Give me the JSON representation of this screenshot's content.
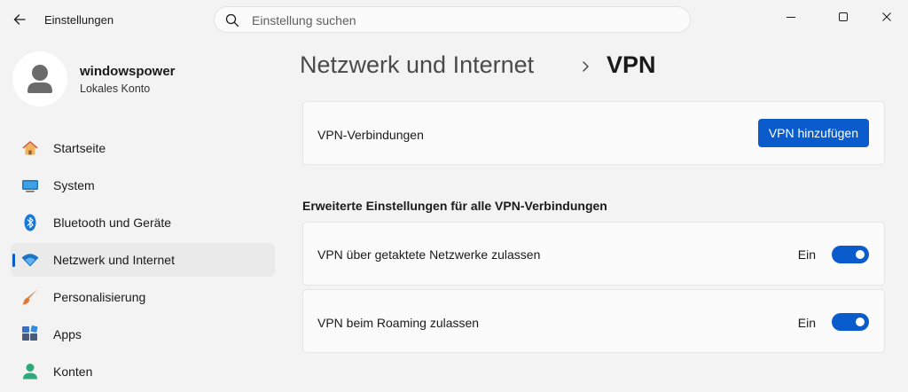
{
  "window": {
    "title": "Einstellungen"
  },
  "search": {
    "placeholder": "Einstellung suchen"
  },
  "profile": {
    "name": "windowspower",
    "account_type": "Lokales Konto"
  },
  "sidebar": {
    "items": [
      {
        "label": "Startseite",
        "icon": "home-icon"
      },
      {
        "label": "System",
        "icon": "monitor-icon"
      },
      {
        "label": "Bluetooth und Geräte",
        "icon": "bluetooth-icon"
      },
      {
        "label": "Netzwerk und Internet",
        "icon": "wifi-icon",
        "active": true
      },
      {
        "label": "Personalisierung",
        "icon": "brush-icon"
      },
      {
        "label": "Apps",
        "icon": "apps-icon"
      },
      {
        "label": "Konten",
        "icon": "user-icon"
      }
    ]
  },
  "breadcrumb": {
    "parent": "Netzwerk und Internet",
    "current": "VPN"
  },
  "vpn_connections": {
    "label": "VPN-Verbindungen",
    "add_button": "VPN hinzufügen"
  },
  "advanced": {
    "title": "Erweiterte Einstellungen für alle VPN-Verbindungen",
    "settings": [
      {
        "label": "VPN über getaktete Netzwerke zulassen",
        "state": "Ein",
        "enabled": true
      },
      {
        "label": "VPN beim Roaming zulassen",
        "state": "Ein",
        "enabled": true
      }
    ]
  },
  "colors": {
    "accent": "#0a5ccc",
    "background": "#f3f3f3",
    "card": "#fbfbfb"
  }
}
